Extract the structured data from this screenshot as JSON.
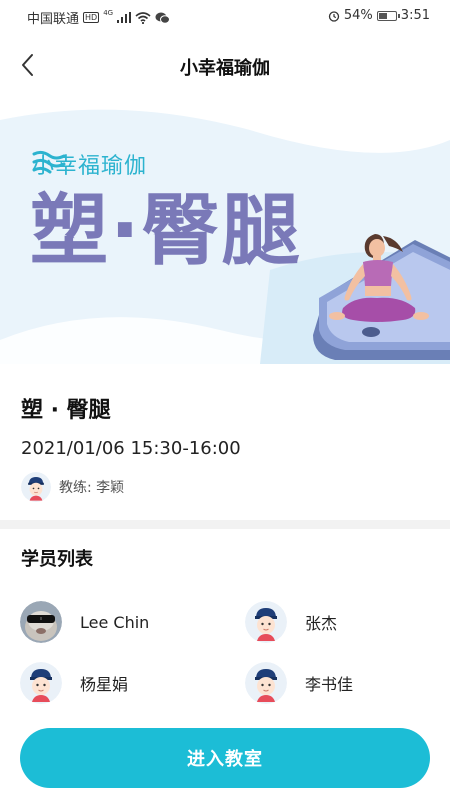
{
  "status_bar": {
    "carrier": "中国联通",
    "hd": "HD",
    "network": "4G",
    "battery": "54%",
    "battery_level": 0.54,
    "time": "3:51"
  },
  "nav": {
    "title": "小幸福瑜伽"
  },
  "banner": {
    "brand": "小幸福瑜伽",
    "title": "塑·臀腿"
  },
  "course": {
    "title": "塑 · 臀腿",
    "time": "2021/01/06 15:30-16:00",
    "coach": "教练: 李颖"
  },
  "students": {
    "title": "学员列表",
    "list": [
      {
        "name": "Lee Chin",
        "avatar": "photo-avatar"
      },
      {
        "name": "张杰",
        "avatar": "default-avatar"
      },
      {
        "name": "杨星娟",
        "avatar": "default-avatar"
      },
      {
        "name": "李书佳",
        "avatar": "default-avatar"
      }
    ]
  },
  "actions": {
    "enter_label": "进入教室"
  },
  "colors": {
    "accent": "#1cbdd6",
    "banner_title": "#7a79b8",
    "brand": "#2cb3cf"
  }
}
